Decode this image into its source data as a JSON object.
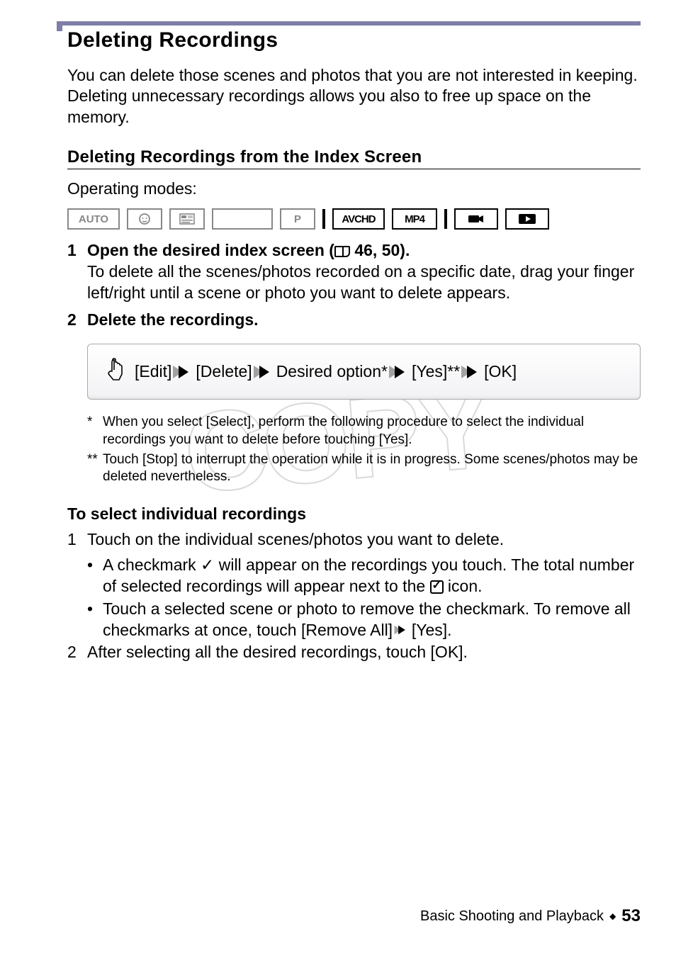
{
  "header": {
    "title": "Deleting Recordings"
  },
  "intro": "You can delete those scenes and photos that you are not interested in keeping. Deleting unnecessary recordings allows you also to free up space on the memory.",
  "sub_title": "Deleting Recordings from the Index Screen",
  "op_label": "Operating modes:",
  "modes": {
    "auto": "AUTO",
    "p": "P",
    "avchd": "AVCHD",
    "mp4": "MP4"
  },
  "steps": {
    "s1_num": "1",
    "s1_title_a": "Open the desired index screen (",
    "s1_title_b": " 46, 50).",
    "s1_body": "To delete all the scenes/photos recorded on a specific date, drag your finger left/right until a scene or photo you want to delete appears.",
    "s2_num": "2",
    "s2_title": "Delete the recordings."
  },
  "action": {
    "a1": "[Edit]",
    "a2": "[Delete]",
    "a3": "Desired option*",
    "a4": "[Yes]**",
    "a5": "[OK]"
  },
  "fn": {
    "m1": "*",
    "t1": "When you select [Select], perform the following procedure to select the individual recordings you want to delete before touching [Yes].",
    "m2": "**",
    "t2": "Touch [Stop] to interrupt the operation while it is in progress. Some scenes/photos may be deleted nevertheless."
  },
  "indiv": {
    "heading": "To select individual recordings",
    "s1_num": "1",
    "s1_text": "Touch on the individual scenes/photos you want to delete.",
    "b1a": "A checkmark ",
    "b1b": " will appear on the recordings you touch. The total number of selected recordings will appear next to the ",
    "b1c": " icon.",
    "b2a": "Touch a selected scene or photo to remove the checkmark. To remove all checkmarks at once, touch [Remove All] ",
    "b2b": " [Yes].",
    "s2_num": "2",
    "s2_text": "After selecting all the desired recordings, touch [OK]."
  },
  "footer": {
    "chapter": "Basic Shooting and Playback",
    "page": "53"
  },
  "watermark": "COPY"
}
